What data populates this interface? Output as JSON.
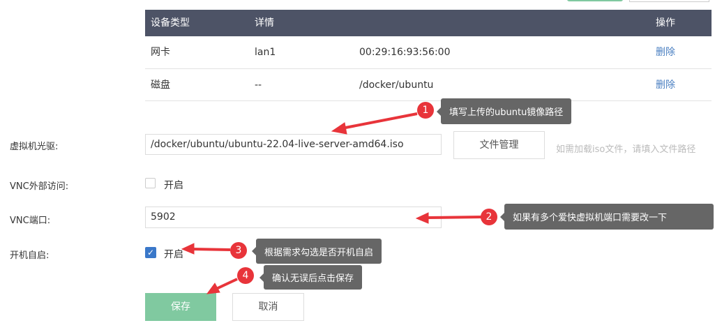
{
  "table": {
    "headers": [
      "设备类型",
      "详情",
      "",
      "操作"
    ],
    "rows": [
      {
        "type": "网卡",
        "detail": "lan1",
        "value": "00:29:16:93:56:00",
        "action": "删除"
      },
      {
        "type": "磁盘",
        "detail": "--",
        "value": "/docker/ubuntu",
        "action": "删除"
      }
    ]
  },
  "form": {
    "cdrom_label": "虚拟机光驱:",
    "cdrom_value": "/docker/ubuntu/ubuntu-22.04-live-server-amd64.iso",
    "file_manager": "文件管理",
    "cdrom_hint": "如需加载iso文件，请填入文件路径",
    "vnc_external_label": "VNC外部访问:",
    "vnc_external_option": "开启",
    "vnc_external_checked": false,
    "vnc_port_label": "VNC端口:",
    "vnc_port_value": "5902",
    "autostart_label": "开机自启:",
    "autostart_option": "开启",
    "autostart_checked": true,
    "save": "保存",
    "cancel": "取消"
  },
  "annotations": [
    {
      "num": "1",
      "text": "填写上传的ubuntu镜像路径"
    },
    {
      "num": "2",
      "text": "如果有多个爱快虚拟机端口需要改一下"
    },
    {
      "num": "3",
      "text": "根据需求勾选是否开机自启"
    },
    {
      "num": "4",
      "text": "确认无误后点击保存"
    }
  ],
  "colors": {
    "header": "#4d5366",
    "save": "#80c9a0",
    "annotation": "#e8343a"
  }
}
